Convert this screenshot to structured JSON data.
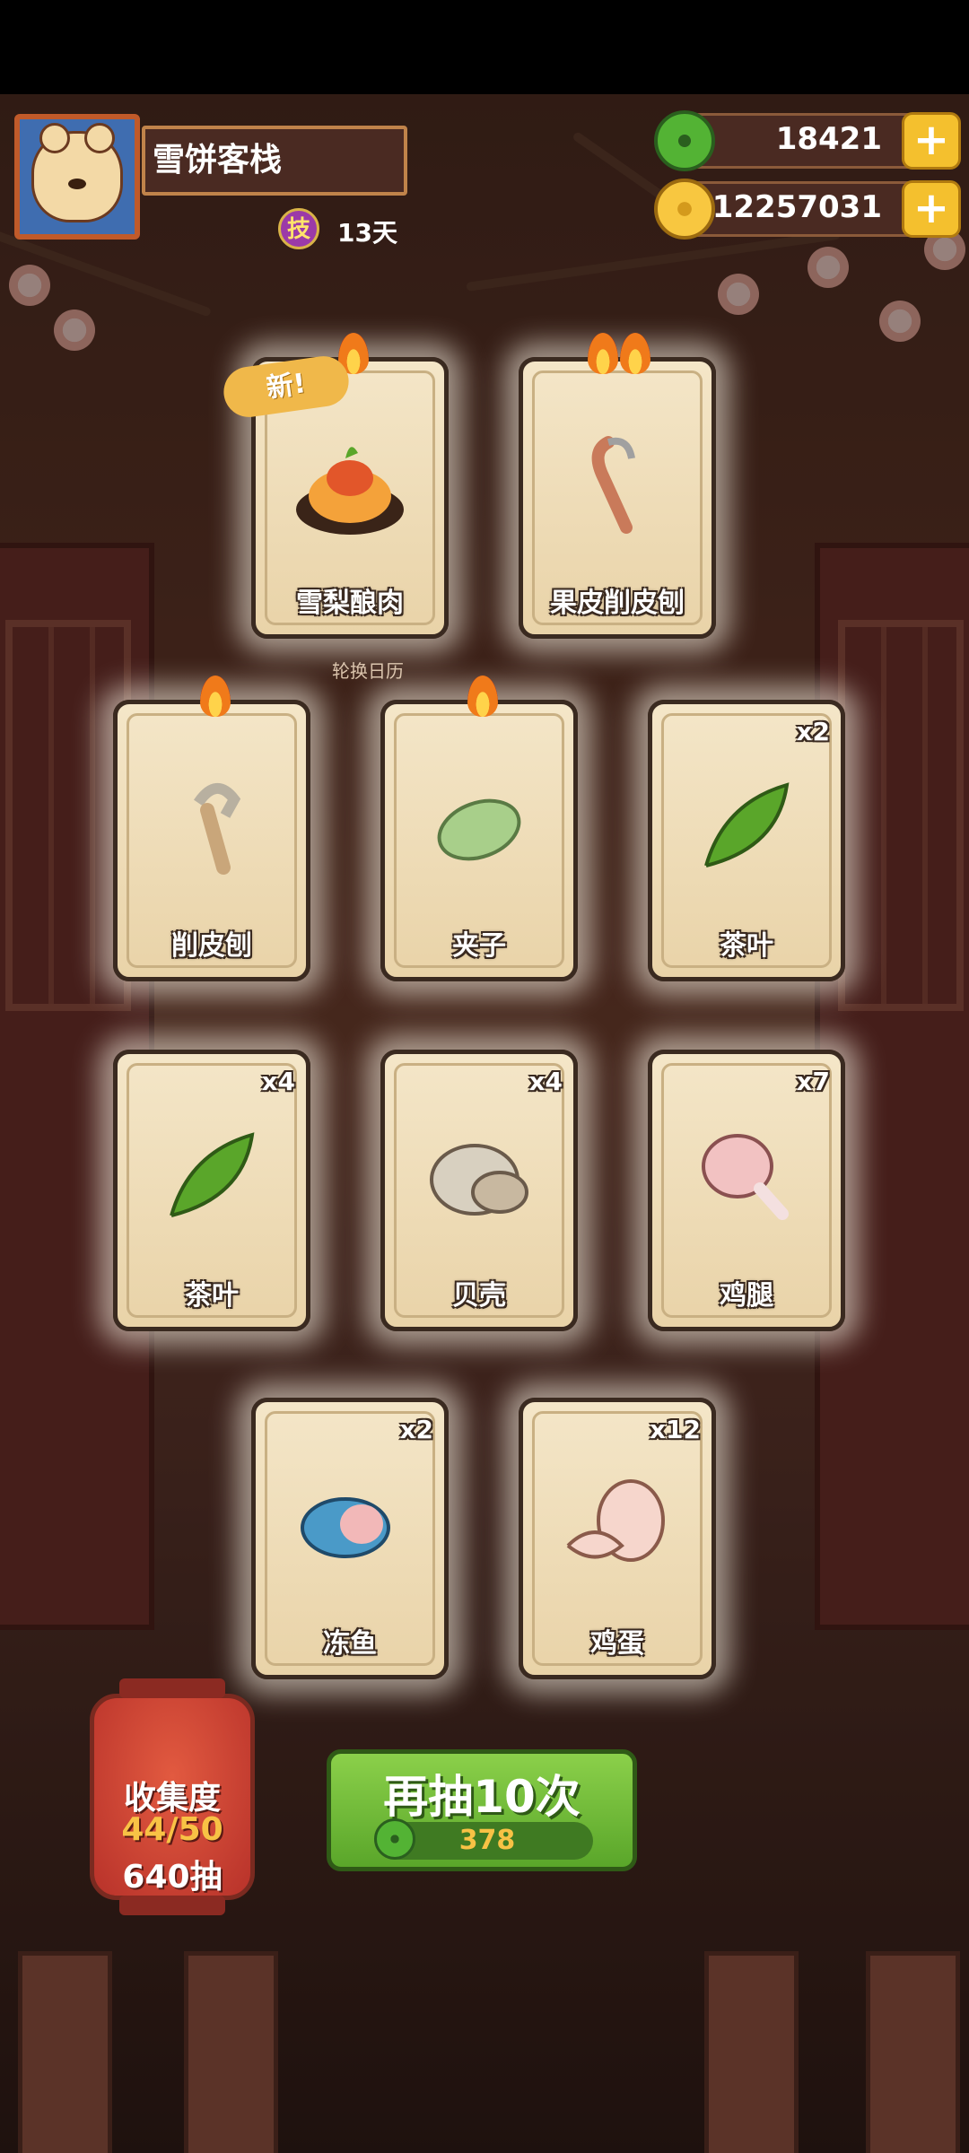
{
  "header": {
    "shop_name": "雪饼客栈",
    "skill_badge": "技",
    "days": "13天",
    "jade_value": "18421",
    "coin_value": "12257031",
    "plus": "+"
  },
  "calendar_label": "轮换日历",
  "new_tag": "新!",
  "cards": [
    {
      "label": "雪梨酿肉",
      "count": "",
      "flames": 1,
      "is_new": true
    },
    {
      "label": "果皮削皮刨",
      "count": "",
      "flames": 2
    },
    {
      "label": "削皮刨",
      "count": "",
      "flames": 1
    },
    {
      "label": "夹子",
      "count": "",
      "flames": 1
    },
    {
      "label": "茶叶",
      "count": "x2",
      "flames": 0
    },
    {
      "label": "茶叶",
      "count": "x4",
      "flames": 0
    },
    {
      "label": "贝壳",
      "count": "x4",
      "flames": 0
    },
    {
      "label": "鸡腿",
      "count": "x7",
      "flames": 0
    },
    {
      "label": "冻鱼",
      "count": "x2",
      "flames": 0
    },
    {
      "label": "鸡蛋",
      "count": "x12",
      "flames": 0
    }
  ],
  "collection": {
    "title": "收集度",
    "progress": "44/50",
    "pulls": "640抽"
  },
  "draw_button": {
    "label": "再抽10次",
    "cost": "378"
  },
  "colors": {
    "jade": "#53b334",
    "coin": "#f8c740",
    "button_green": "#6ab838",
    "lantern_red": "#c8382c"
  }
}
